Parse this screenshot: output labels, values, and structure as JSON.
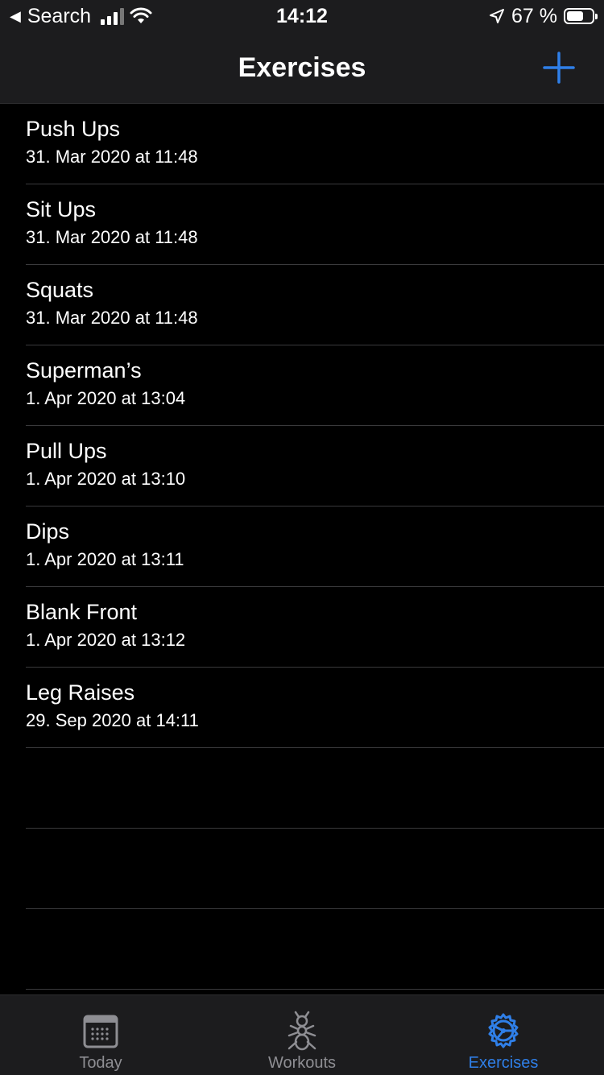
{
  "status_bar": {
    "back_label": "Search",
    "time": "14:12",
    "battery": "67 %",
    "battery_level": 0.67
  },
  "nav": {
    "title": "Exercises",
    "add_icon": "plus-icon"
  },
  "exercises": [
    {
      "name": "Push Ups",
      "date": "31. Mar 2020 at 11:48"
    },
    {
      "name": "Sit Ups",
      "date": "31. Mar 2020 at 11:48"
    },
    {
      "name": "Squats",
      "date": "31. Mar 2020 at 11:48"
    },
    {
      "name": "Superman’s",
      "date": "1. Apr 2020 at 13:04"
    },
    {
      "name": "Pull Ups",
      "date": "1. Apr 2020 at 13:10"
    },
    {
      "name": "Dips",
      "date": "1. Apr 2020 at 13:11"
    },
    {
      "name": "Blank Front",
      "date": "1. Apr 2020 at 13:12"
    },
    {
      "name": "Leg Raises",
      "date": "29. Sep 2020 at 14:11"
    }
  ],
  "tabs": [
    {
      "label": "Today",
      "icon": "calendar-icon",
      "active": false
    },
    {
      "label": "Workouts",
      "icon": "ant-icon",
      "active": false
    },
    {
      "label": "Exercises",
      "icon": "gear-icon",
      "active": true
    }
  ],
  "colors": {
    "accent": "#2f7fe8",
    "bar_background": "#1c1c1e",
    "background": "#000000",
    "inactive": "#8e8e93"
  }
}
